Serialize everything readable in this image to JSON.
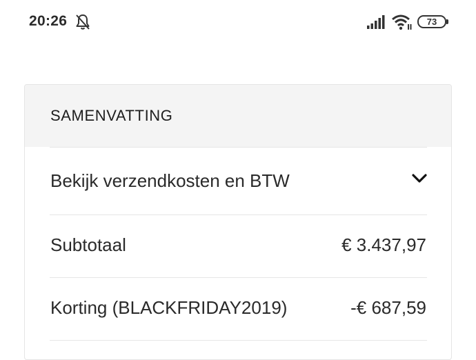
{
  "status_bar": {
    "time": "20:26",
    "battery": "73",
    "icons": [
      "bell-off-icon",
      "signal-icon",
      "wifi-icon",
      "battery-icon"
    ]
  },
  "summary": {
    "title": "SAMENVATTING",
    "shipping_toggle": {
      "label": "Bekijk verzendkosten en BTW",
      "icon": "chevron-down-icon"
    },
    "subtotal": {
      "label": "Subtotaal",
      "value": "€ 3.437,97"
    },
    "discount": {
      "label": "Korting (BLACKFRIDAY2019)",
      "value": "-€ 687,59"
    }
  }
}
